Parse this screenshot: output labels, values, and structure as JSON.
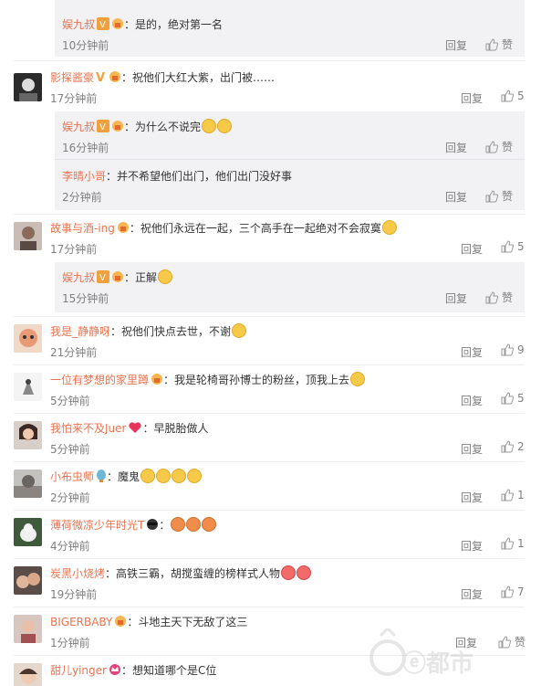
{
  "comments": [
    {
      "name": "娱九叔",
      "text": "：是的，绝对第一名",
      "time": "10分钟前",
      "reply": "回复",
      "like": "赞"
    },
    {
      "name": "影探酱豪",
      "text": "：祝他们大红大紫，出门被……",
      "time": "17分钟前",
      "reply": "回复",
      "like": "5"
    },
    {
      "name": "娱九叔",
      "text": "：为什么不说完",
      "time": "16分钟前",
      "reply": "回复",
      "like": "赞"
    },
    {
      "name": "李晴小哥",
      "text": "：并不希望他们出门，他们出门没好事",
      "time": "2分钟前",
      "reply": "回复",
      "like": "赞"
    },
    {
      "name": "故事与酒-ing",
      "text": "：祝他们永远在一起，三个高手在一起绝对不会寂寞",
      "time": "17分钟前",
      "reply": "回复",
      "like": "5"
    },
    {
      "name": "娱九叔",
      "text": "：正解",
      "time": "15分钟前",
      "reply": "回复",
      "like": "赞"
    },
    {
      "name": "我是_静静呀",
      "text": "：祝他们快点去世，不谢",
      "time": "21分钟前",
      "reply": "回复",
      "like": "9"
    },
    {
      "name": "一位有梦想的家里蹲",
      "text": "：我是轮椅哥孙博士的粉丝，顶我上去",
      "time": "5分钟前",
      "reply": "回复",
      "like": "5"
    },
    {
      "name": "我怕来不及Juer",
      "text": "：早脱胎做人",
      "time": "5分钟前",
      "reply": "回复",
      "like": "2"
    },
    {
      "name": "小布虫师",
      "text": "：魔鬼",
      "time": "2分钟前",
      "reply": "回复",
      "like": "1"
    },
    {
      "name": "薄荷微凉少年时光T",
      "text": "：",
      "time": "4分钟前",
      "reply": "回复",
      "like": "1"
    },
    {
      "name": "炭黑小烧烤",
      "text": "：高铁三霸，胡搅蛮缠的榜样式人物",
      "time": "19分钟前",
      "reply": "回复",
      "like": "7"
    },
    {
      "name": "BIGERBABY",
      "text": "：斗地主天下无敌了这三",
      "time": "1分钟前",
      "reply": "回复",
      "like": "赞"
    },
    {
      "name": "甜儿yinger",
      "text": "：想知道哪个是C位",
      "time": "",
      "reply": "",
      "like": ""
    }
  ],
  "watermark": "ⓔ都市"
}
